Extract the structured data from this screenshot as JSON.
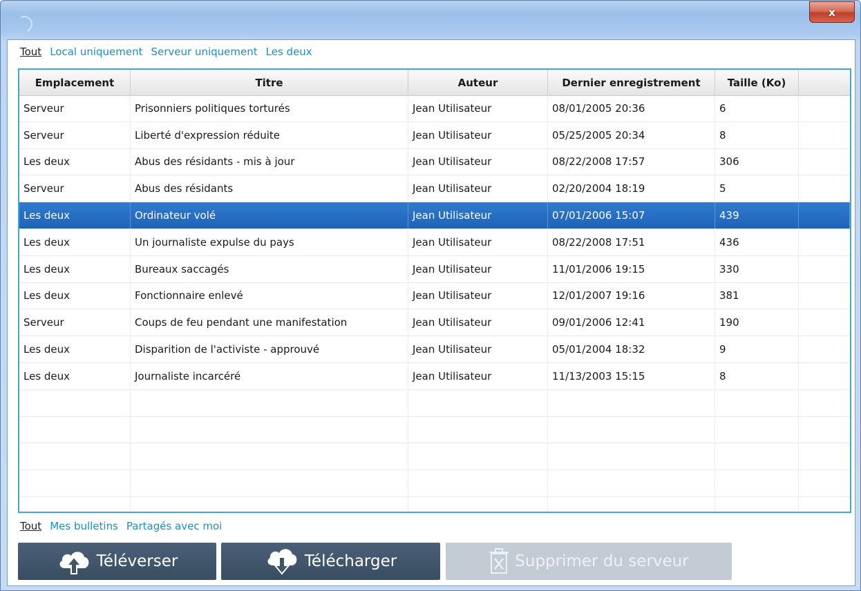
{
  "window": {
    "title": "",
    "close_label": "x"
  },
  "location_filter": {
    "items": [
      "Tout",
      "Local uniquement",
      "Serveur uniquement",
      "Les deux"
    ],
    "active": "Tout"
  },
  "table": {
    "columns": [
      "Emplacement",
      "Titre",
      "Auteur",
      "Dernier enregistrement",
      "Taille (Ko)",
      ""
    ],
    "rows": [
      {
        "location": "Serveur",
        "title": "Prisonniers politiques torturés",
        "author": "Jean Utilisateur",
        "saved": "08/01/2005 20:36",
        "size": "6",
        "selected": false
      },
      {
        "location": "Serveur",
        "title": "Liberté d'expression réduite",
        "author": "Jean Utilisateur",
        "saved": "05/25/2005 20:34",
        "size": "8",
        "selected": false
      },
      {
        "location": "Les deux",
        "title": "Abus des résidants - mis à jour",
        "author": "Jean Utilisateur",
        "saved": "08/22/2008 17:57",
        "size": "306",
        "selected": false
      },
      {
        "location": "Serveur",
        "title": "Abus des résidants",
        "author": "Jean Utilisateur",
        "saved": "02/20/2004 18:19",
        "size": "5",
        "selected": false
      },
      {
        "location": "Les deux",
        "title": "Ordinateur volé",
        "author": "Jean Utilisateur",
        "saved": "07/01/2006 15:07",
        "size": "439",
        "selected": true
      },
      {
        "location": "Les deux",
        "title": "Un journaliste expulse du pays",
        "author": "Jean Utilisateur",
        "saved": "08/22/2008 17:51",
        "size": "436",
        "selected": false
      },
      {
        "location": "Les deux",
        "title": "Bureaux saccagés",
        "author": "Jean Utilisateur",
        "saved": "11/01/2006 19:15",
        "size": "330",
        "selected": false
      },
      {
        "location": "Les deux",
        "title": "Fonctionnaire enlevé",
        "author": "Jean Utilisateur",
        "saved": "12/01/2007 19:16",
        "size": "381",
        "selected": false
      },
      {
        "location": "Serveur",
        "title": "Coups de feu pendant une manifestation",
        "author": "Jean Utilisateur",
        "saved": "09/01/2006 12:41",
        "size": "190",
        "selected": false
      },
      {
        "location": "Les deux",
        "title": "Disparition de l'activiste - approuvé",
        "author": "Jean Utilisateur",
        "saved": "05/01/2004 18:32",
        "size": "9",
        "selected": false
      },
      {
        "location": "Les deux",
        "title": "Journaliste incarcéré",
        "author": "Jean Utilisateur",
        "saved": "11/13/2003 15:15",
        "size": "8",
        "selected": false
      }
    ],
    "empty_rows": 5
  },
  "owner_filter": {
    "items": [
      "Tout",
      "Mes bulletins",
      "Partagés avec moi"
    ],
    "active": "Tout"
  },
  "actions": {
    "upload_label": "Téléverser",
    "download_label": "Télécharger",
    "delete_label": "Supprimer du serveur",
    "delete_enabled": false
  },
  "colors": {
    "accent_link": "#1b8fc2",
    "selection": "#2a72c8",
    "button_dark": "#44586d",
    "button_disabled": "#c3ccd5"
  }
}
